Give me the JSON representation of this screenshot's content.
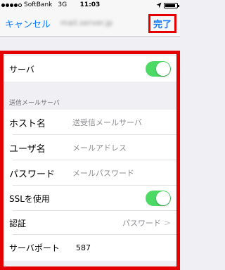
{
  "status_bar": {
    "carrier": "SoftBank",
    "network": "3G",
    "time": "11:03",
    "signal_bars": 4,
    "signal_total": 5,
    "battery_level": 0.9
  },
  "nav": {
    "cancel": "キャンセル",
    "title": "mail.server.jp",
    "done": "完了"
  },
  "form": {
    "server": {
      "label": "サーバ",
      "enabled": true
    },
    "section_header": "送信メールサーバ",
    "host": {
      "label": "ホスト名",
      "placeholder": "送受信メールサーバ"
    },
    "user": {
      "label": "ユーザ名",
      "placeholder": "メールアドレス"
    },
    "password": {
      "label": "パスワード",
      "placeholder": "メールパスワード"
    },
    "ssl": {
      "label": "SSLを使用",
      "enabled": true
    },
    "auth": {
      "label": "認証",
      "value": "パスワード"
    },
    "port": {
      "label": "サーバポート",
      "value": "587"
    }
  },
  "colors": {
    "accent": "#0a7aff",
    "toggle_on": "#4cd964",
    "highlight": "#e50000"
  }
}
